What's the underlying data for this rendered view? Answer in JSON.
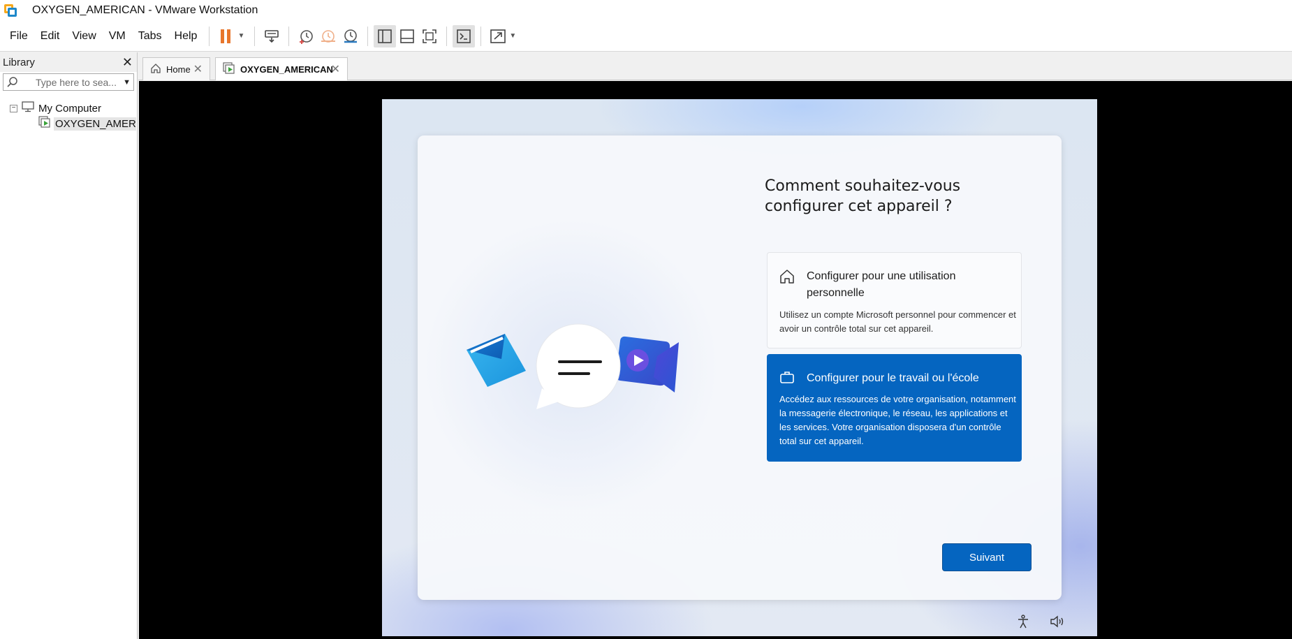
{
  "window": {
    "title": "OXYGEN_AMERICAN - VMware Workstation",
    "app_icon": "vmware-icon"
  },
  "menu": {
    "items": [
      "File",
      "Edit",
      "View",
      "VM",
      "Tabs",
      "Help"
    ]
  },
  "toolbar": {
    "icons": [
      "pause-icon",
      "send-ctrl-alt-del-icon",
      "snapshot-icon",
      "revert-snapshot-icon",
      "snapshot-manager-icon",
      "show-library-icon",
      "thumbnail-bar-icon",
      "full-screen-icon",
      "console-view-icon",
      "stretch-guest-icon"
    ],
    "accent": "#e8762c"
  },
  "library": {
    "title": "Library",
    "close": "✕",
    "search_placeholder": "Type here to sea...",
    "tree": {
      "root": "My Computer",
      "expander": "−",
      "vm": "OXYGEN_AMERIC"
    }
  },
  "tabs": [
    {
      "label": "Home",
      "icon": "home-icon",
      "close": "✕"
    },
    {
      "label": "OXYGEN_AMERICAN",
      "icon": "vm-running-icon",
      "close": "✕"
    }
  ],
  "oobe": {
    "title": "Comment souhaitez-vous configurer cet appareil ?",
    "options": [
      {
        "icon": "home-icon",
        "title": "Configurer pour une utilisation personnelle",
        "description": "Utilisez un compte Microsoft personnel pour commencer et avoir un contrôle total sur cet appareil.",
        "selected": false
      },
      {
        "icon": "briefcase-icon",
        "title": "Configurer pour le travail ou l'école",
        "description": "Accédez aux ressources de votre organisation, notamment la messagerie électronique, le réseau, les applications et les services. Votre organisation disposera d'un contrôle total sur cet appareil.",
        "selected": true
      }
    ],
    "next_button": "Suivant",
    "accent": "#0565c0",
    "bottom_icons": [
      "accessibility-icon",
      "volume-icon"
    ]
  }
}
